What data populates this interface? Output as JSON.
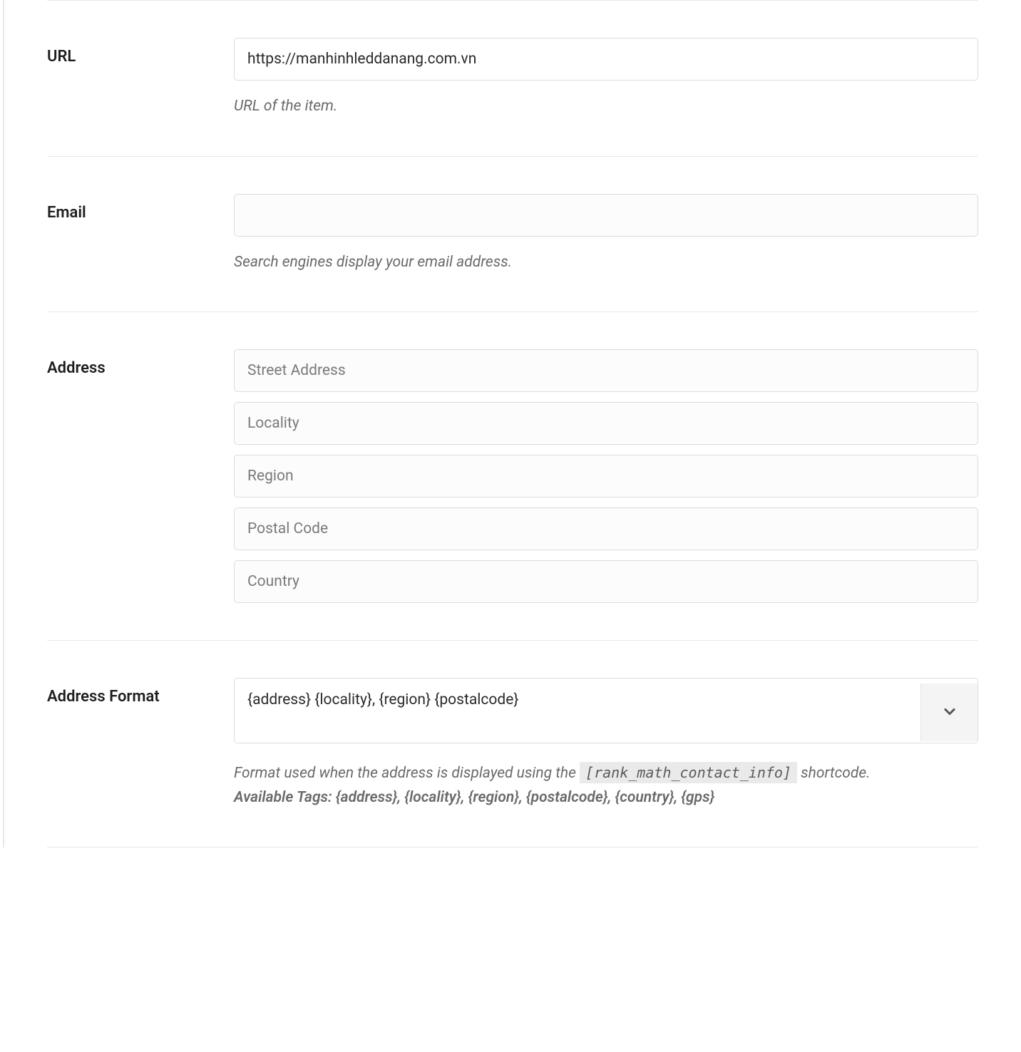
{
  "fields": {
    "url": {
      "label": "URL",
      "value": "https://manhinhleddanang.com.vn",
      "helper": "URL of the item."
    },
    "email": {
      "label": "Email",
      "value": "",
      "helper": "Search engines display your email address."
    },
    "address": {
      "label": "Address",
      "street_placeholder": "Street Address",
      "locality_placeholder": "Locality",
      "region_placeholder": "Region",
      "postal_placeholder": "Postal Code",
      "country_placeholder": "Country"
    },
    "address_format": {
      "label": "Address Format",
      "value": "{address} {locality}, {region} {postalcode}",
      "helper_prefix": "Format used when the address is displayed using the ",
      "helper_code": "[rank_math_contact_info]",
      "helper_suffix": " shortcode.",
      "tags_label": "Available Tags: ",
      "tags_value": "{address}, {locality}, {region}, {postalcode}, {country}, {gps}"
    }
  }
}
